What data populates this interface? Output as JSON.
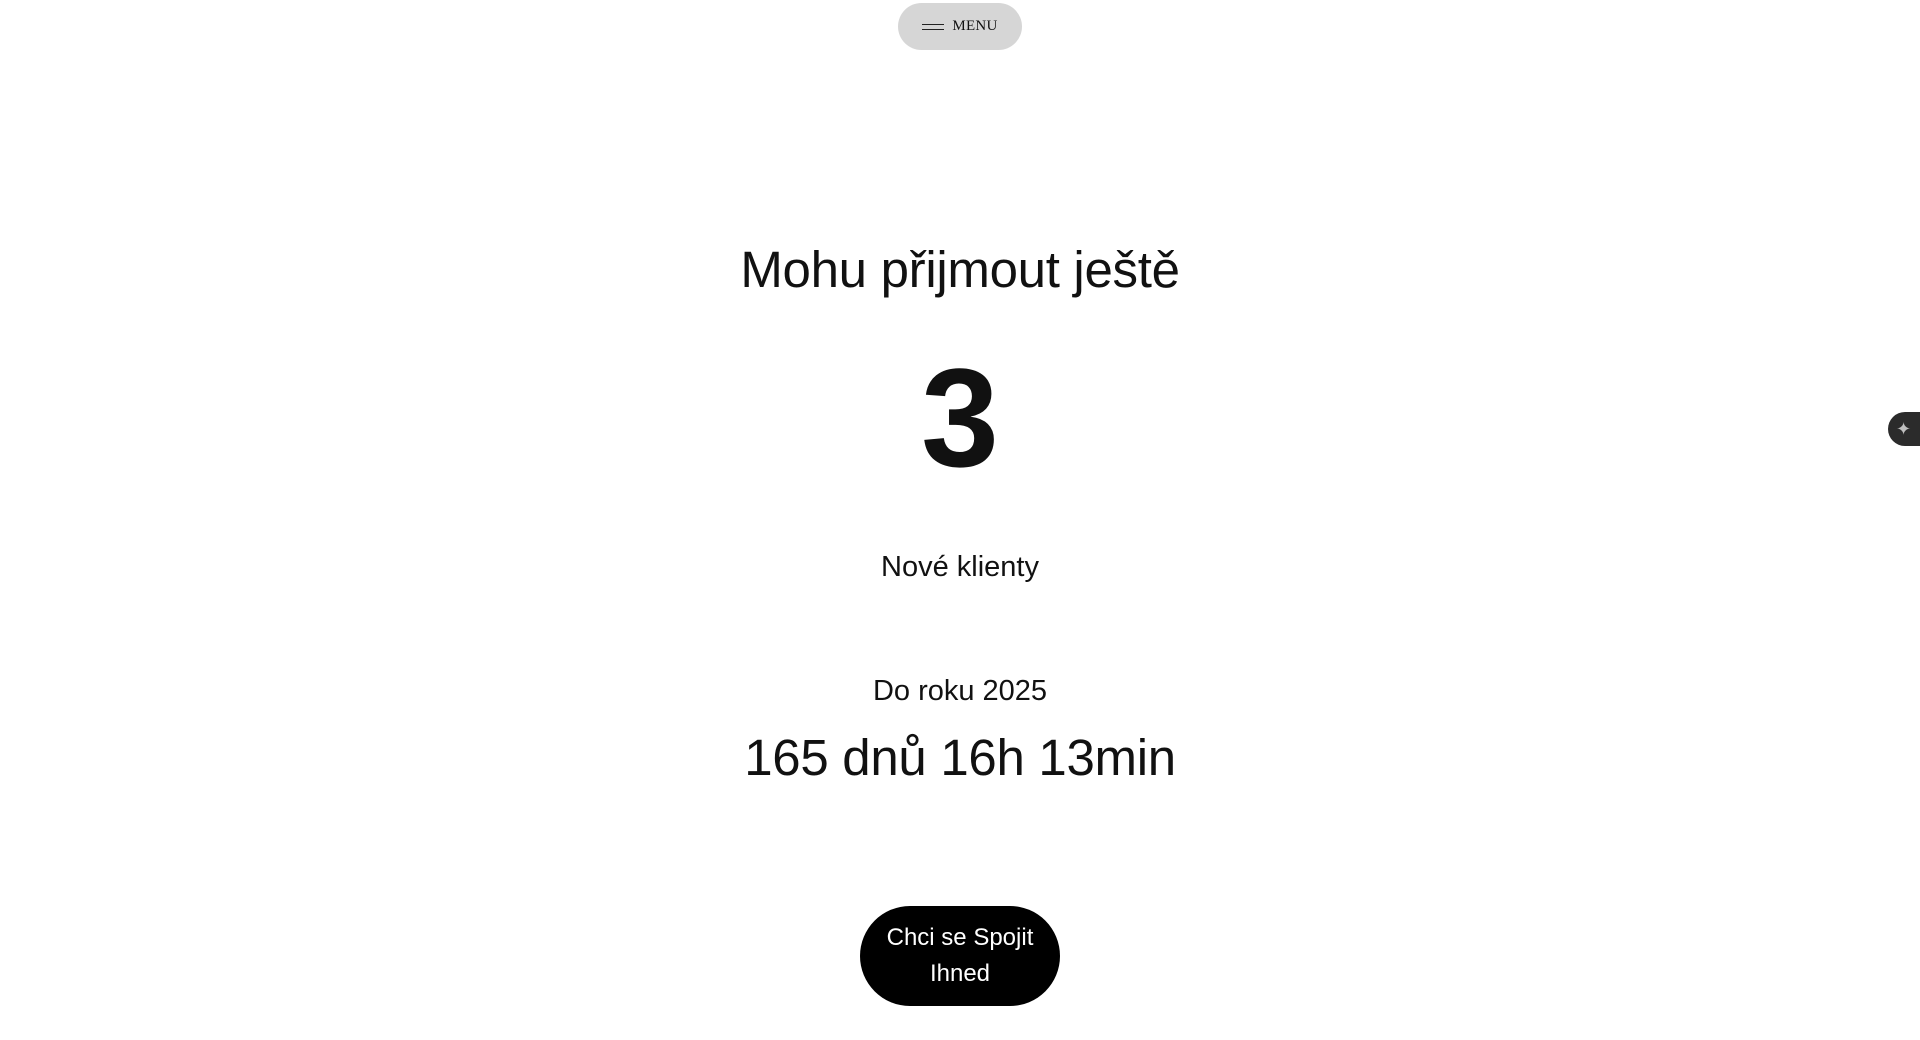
{
  "header": {
    "menu_label": "MENU",
    "menu_icon": "hamburger-icon"
  },
  "main": {
    "heading": "Mohu přijmout ještě",
    "count": "3",
    "subtitle": "Nové klienty",
    "deadline_label": "Do roku 2025",
    "countdown": "165 dnů 16h 13min",
    "cta_label": "Chci se Spojit Ihned"
  },
  "side_widget": {
    "icon": "sparkle-icon"
  },
  "colors": {
    "background": "#ffffff",
    "menu_bg": "#d6d6d6",
    "cta_bg": "#000000",
    "cta_text": "#ffffff",
    "text": "#111111"
  }
}
